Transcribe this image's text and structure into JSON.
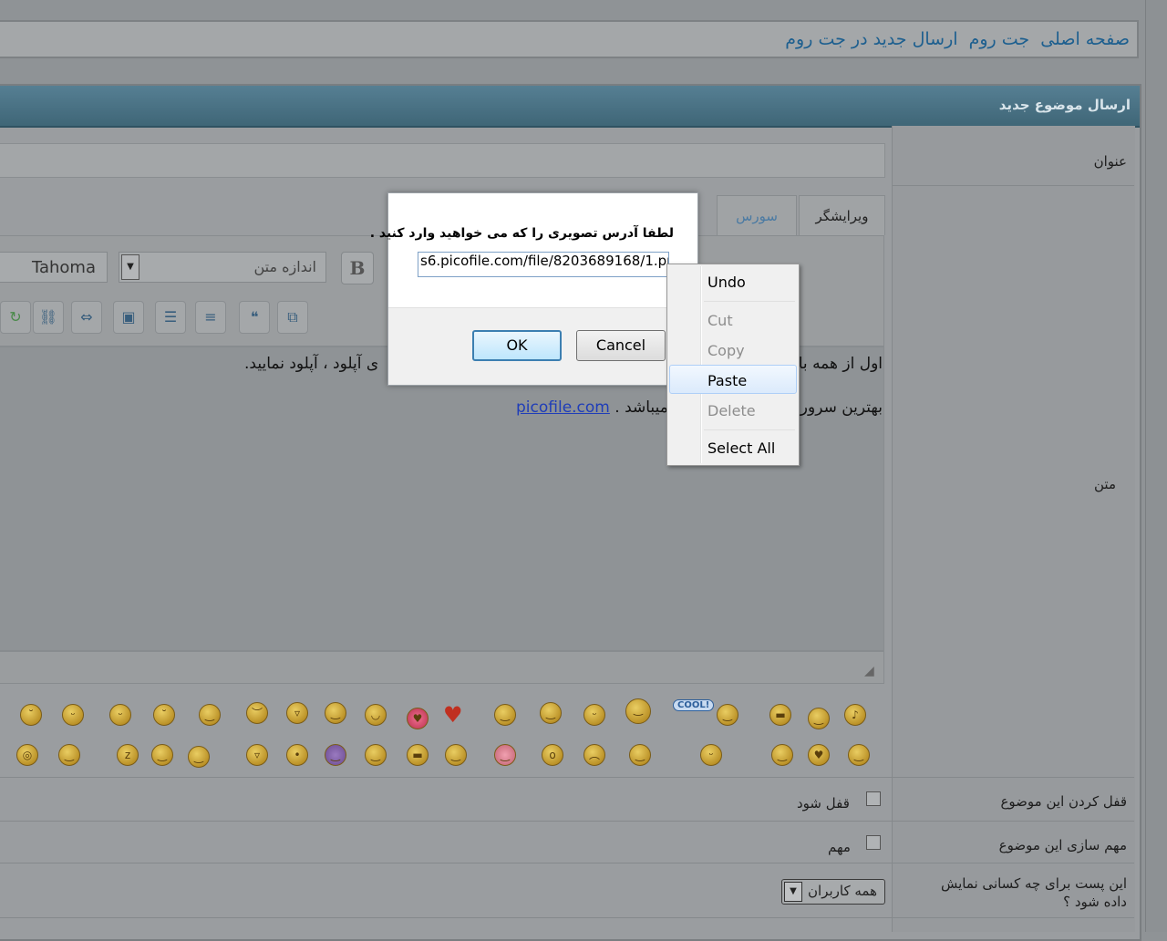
{
  "breadcrumb": [
    "صفحه اصلی",
    "جت روم",
    "ارسال جدید در جت روم"
  ],
  "panel": {
    "title": "ارسال موضوع جدید"
  },
  "labels": {
    "title": "عنوان",
    "text": "متن",
    "lock_topic": "قفل کردن این موضوع",
    "sticky_topic": "مهم سازی این موضوع",
    "visibility_line1": "این پست برای چه کسانی نمایش",
    "visibility_line2": "داده شود ؟"
  },
  "editor": {
    "tabs": {
      "wysiwyg": "ویرایشگر",
      "source": "سورس"
    },
    "font": "Tahoma",
    "font_size_placeholder": "اندازه متن",
    "bold": "B",
    "content_line1_right": "اول از همه با",
    "content_line1_left": "ی آپلود ، آپلود نمایید.",
    "content_line2_right": "بهترین سرور",
    "content_line2_link": "picofile.com",
    "content_line2_end": "میباشد ."
  },
  "options": {
    "lock_label": "قفل شود",
    "sticky_label": "مهم",
    "visibility_value": "همه کاربران"
  },
  "dialog": {
    "prompt": "لطفا آدرس تصویری را که می خواهید وارد کنید .",
    "input_value": "s6.picofile.com/file/8203689168/1.png",
    "ok": "OK",
    "cancel": "Cancel"
  },
  "context_menu": {
    "undo": "Undo",
    "cut": "Cut",
    "copy": "Copy",
    "paste": "Paste",
    "delete": "Delete",
    "select_all": "Select All"
  },
  "smileys": {
    "cool_badge": "COOL!"
  }
}
